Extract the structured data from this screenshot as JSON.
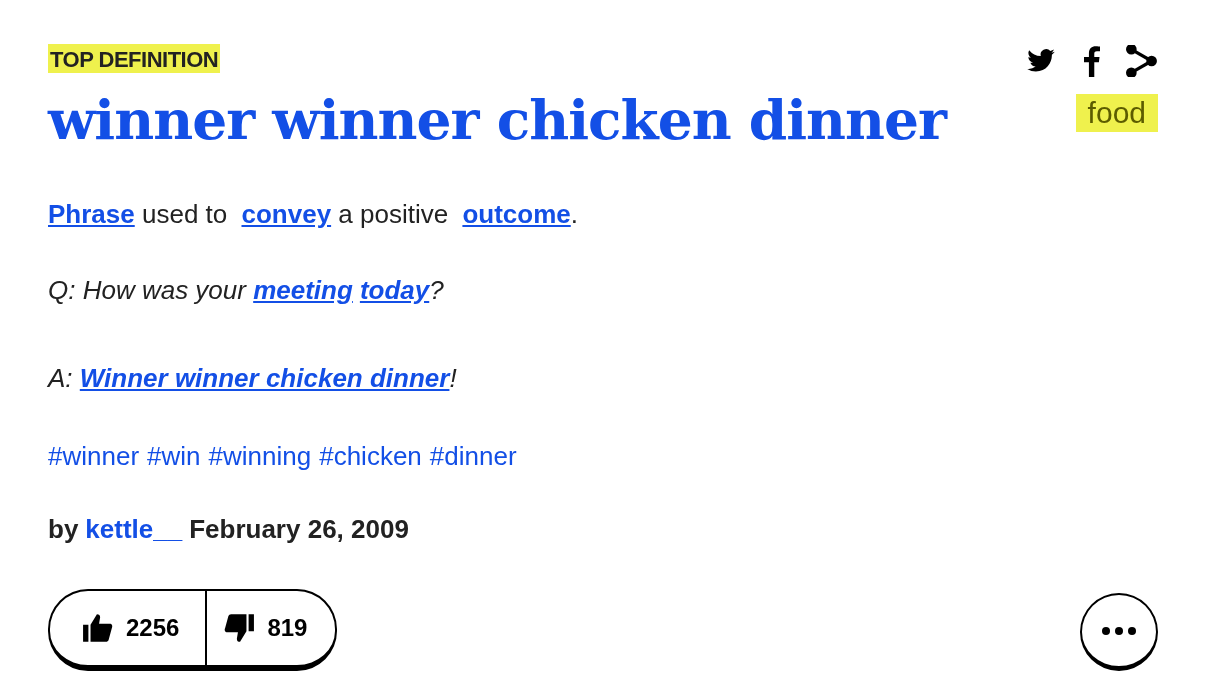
{
  "badge": "TOP DEFINITION",
  "title": "winner winner chicken dinner",
  "share_icons": [
    {
      "kind": "twitter"
    },
    {
      "kind": "facebook"
    },
    {
      "kind": "share"
    }
  ],
  "tags": [
    "food"
  ],
  "meaning": [
    {
      "kind": "link",
      "text": "Phrase"
    },
    {
      "kind": "text",
      "text": " used to "
    },
    {
      "kind": "link",
      "text": "convey"
    },
    {
      "kind": "text",
      "text": " a positive "
    },
    {
      "kind": "link",
      "text": "outcome"
    },
    {
      "kind": "text",
      "text": "."
    }
  ],
  "example": [
    [
      {
        "kind": "text",
        "text": "Q: How was your "
      },
      {
        "kind": "link",
        "text": "meeting"
      },
      {
        "kind": "link",
        "text": "today"
      },
      {
        "kind": "text",
        "text": "?"
      }
    ],
    [
      {
        "kind": "text",
        "text": "A: "
      },
      {
        "kind": "link",
        "text": "Winner winner chicken dinner"
      },
      {
        "kind": "text",
        "text": "!"
      }
    ]
  ],
  "hashtags": [
    "#winner",
    "#win",
    "#winning",
    "#chicken",
    "#dinner"
  ],
  "author": {
    "prefix": "by",
    "name": "kettle__",
    "date": "February 26, 2009"
  },
  "votes": {
    "up": "2256",
    "down": "819"
  }
}
